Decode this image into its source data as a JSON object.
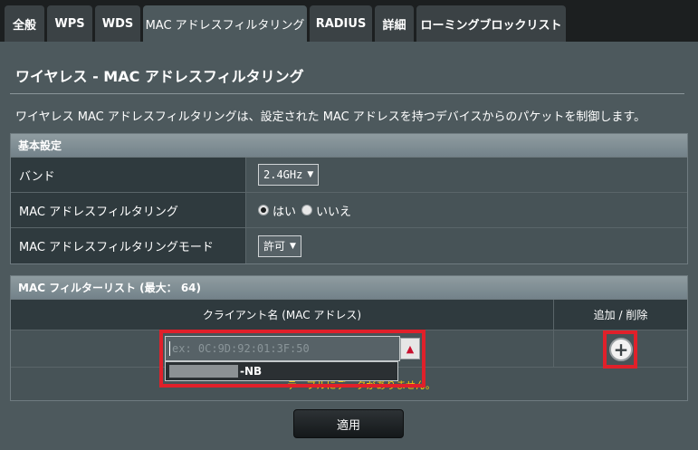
{
  "tabs": [
    {
      "label": "全般"
    },
    {
      "label": "WPS"
    },
    {
      "label": "WDS"
    },
    {
      "label": "MAC アドレスフィルタリング"
    },
    {
      "label": "RADIUS"
    },
    {
      "label": "詳細"
    },
    {
      "label": "ローミングブロックリスト"
    }
  ],
  "page": {
    "title": "ワイヤレス - MAC アドレスフィルタリング",
    "description": "ワイヤレス MAC アドレスフィルタリングは、設定された MAC アドレスを持つデバイスからのパケットを制御します。"
  },
  "basic": {
    "header": "基本設定",
    "band_label": "バンド",
    "band_value": "2.4GHz",
    "filter_label": "MAC アドレスフィルタリング",
    "yes_label": "はい",
    "no_label": "いいえ",
    "mode_label": "MAC アドレスフィルタリングモード",
    "mode_value": "許可"
  },
  "mac_list": {
    "header": "MAC フィルターリスト (最大： 64)",
    "col_client": "クライアント名 (MAC アドレス)",
    "col_action": "追加 / 削除",
    "input_placeholder": "ex: 0C:9D:92:01:3F:50",
    "dropdown_suffix": "-NB",
    "empty_note": "テーブルにデータがありません。"
  },
  "apply_label": "適用",
  "colors": {
    "panel": "#4d595d",
    "highlight": "#e0202a",
    "tab_bg": "#3b4245"
  }
}
